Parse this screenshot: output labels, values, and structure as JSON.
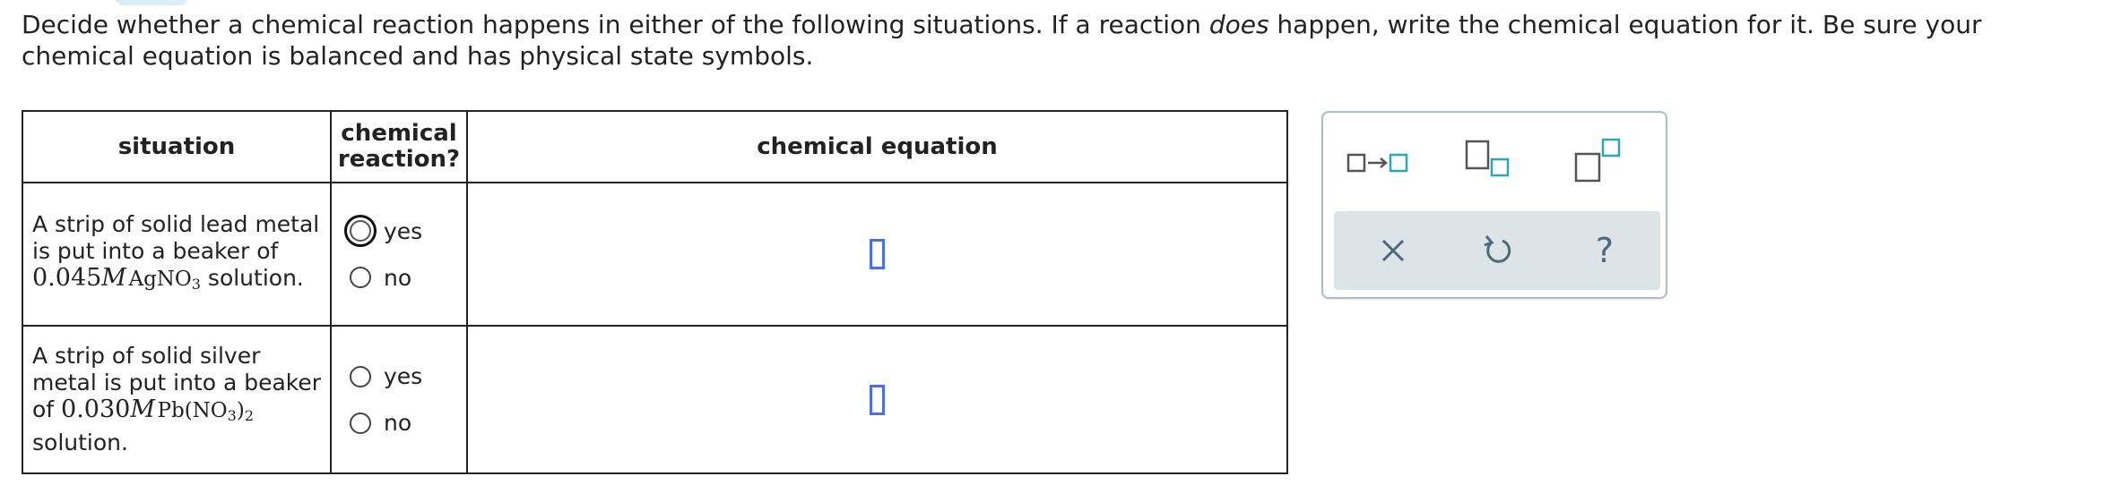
{
  "instructions": {
    "part1": "Decide whether a chemical reaction happens in either of the following situations. If a reaction ",
    "emphasis": "does",
    "part2": " happen, write the chemical equation for it. Be sure your chemical equation is balanced and has physical state symbols."
  },
  "table": {
    "headers": {
      "situation": "situation",
      "reaction_line1": "chemical",
      "reaction_line2": "reaction?",
      "equation": "chemical equation"
    },
    "rows": [
      {
        "line1": "A strip of solid lead metal",
        "line2": "is put into a beaker of",
        "conc": "0.045",
        "unit": "M",
        "formula_a": "AgNO",
        "formula_a_sub": "3",
        "tail": " solution.",
        "yes_label": "yes",
        "no_label": "no"
      },
      {
        "line1": "A strip of solid silver",
        "line2": "metal is put into a beaker",
        "prefix": "of ",
        "conc": "0.030",
        "unit": "M",
        "formula_a": "Pb(NO",
        "formula_a_sub": "3",
        "formula_b": ")",
        "formula_b_sub": "2",
        "line4": "solution.",
        "yes_label": "yes",
        "no_label": "no"
      }
    ]
  },
  "palette": {
    "tools": [
      "reaction-arrow-icon",
      "subscript-icon",
      "superscript-icon"
    ],
    "actions": [
      "clear-icon",
      "undo-icon",
      "help-icon"
    ],
    "help_label": "?",
    "clear_label": "×",
    "border_color": "#a9c0cc",
    "accent_color": "#2aa7b8",
    "panel_color": "#dde4e8"
  },
  "colors": {
    "answer_box": "#4a6ee8"
  }
}
